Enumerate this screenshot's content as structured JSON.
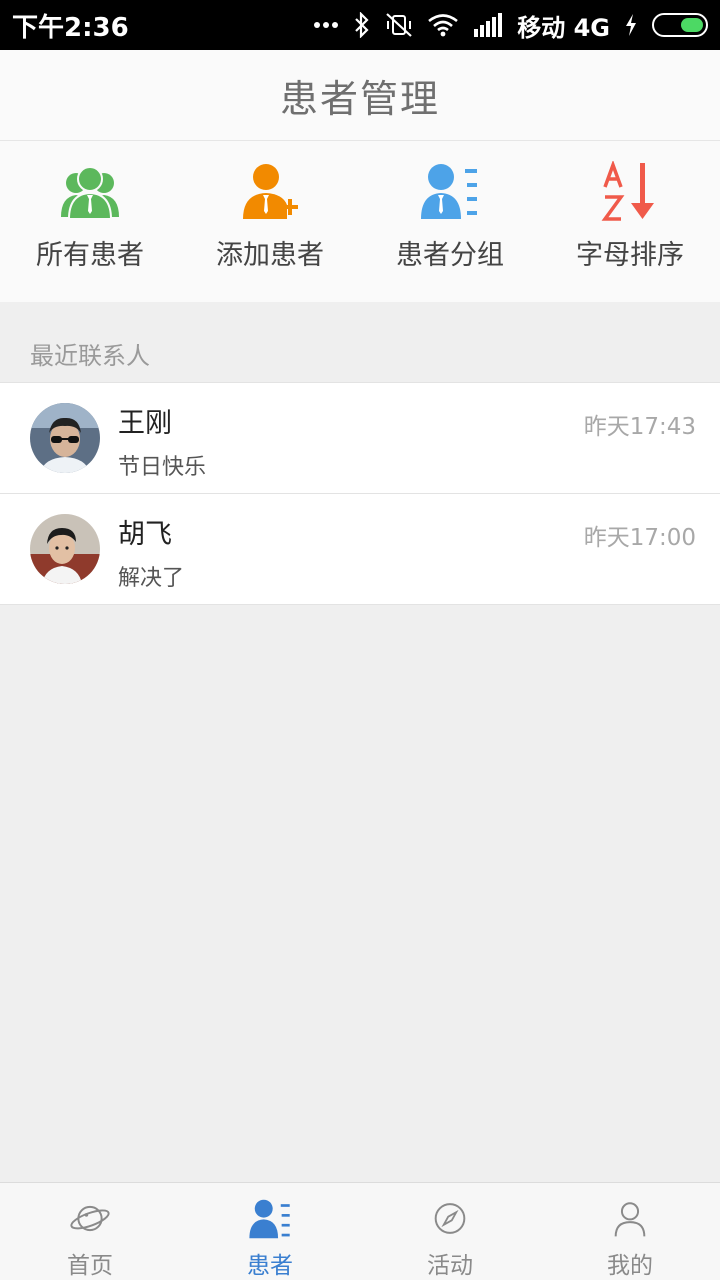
{
  "status_bar": {
    "time": "下午2:36",
    "carrier": "移动 4G",
    "icons": [
      "more-dots-icon",
      "bluetooth-icon",
      "vibrate-off-icon",
      "wifi-icon",
      "signal-icon",
      "charging-icon",
      "battery-icon"
    ]
  },
  "header": {
    "title": "患者管理"
  },
  "quick_actions": [
    {
      "label": "所有患者",
      "icon": "all-patients-icon",
      "color": "#5cb85c"
    },
    {
      "label": "添加患者",
      "icon": "add-patient-icon",
      "color": "#f28a00"
    },
    {
      "label": "患者分组",
      "icon": "patient-group-icon",
      "color": "#4da3e8"
    },
    {
      "label": "字母排序",
      "icon": "alphabet-sort-icon",
      "color": "#f05a4a"
    }
  ],
  "recent": {
    "label": "最近联系人",
    "contacts": [
      {
        "name": "王刚",
        "message": "节日快乐",
        "time": "昨天17:43"
      },
      {
        "name": "胡飞",
        "message": "解决了",
        "time": "昨天17:00"
      }
    ]
  },
  "tabs": [
    {
      "label": "首页",
      "icon": "planet-icon",
      "active": false
    },
    {
      "label": "患者",
      "icon": "patient-list-icon",
      "active": true
    },
    {
      "label": "活动",
      "icon": "compass-icon",
      "active": false
    },
    {
      "label": "我的",
      "icon": "profile-icon",
      "active": false
    }
  ],
  "colors": {
    "accent": "#3a7fd0",
    "background": "#efefef",
    "header_bg": "#fafafa"
  }
}
